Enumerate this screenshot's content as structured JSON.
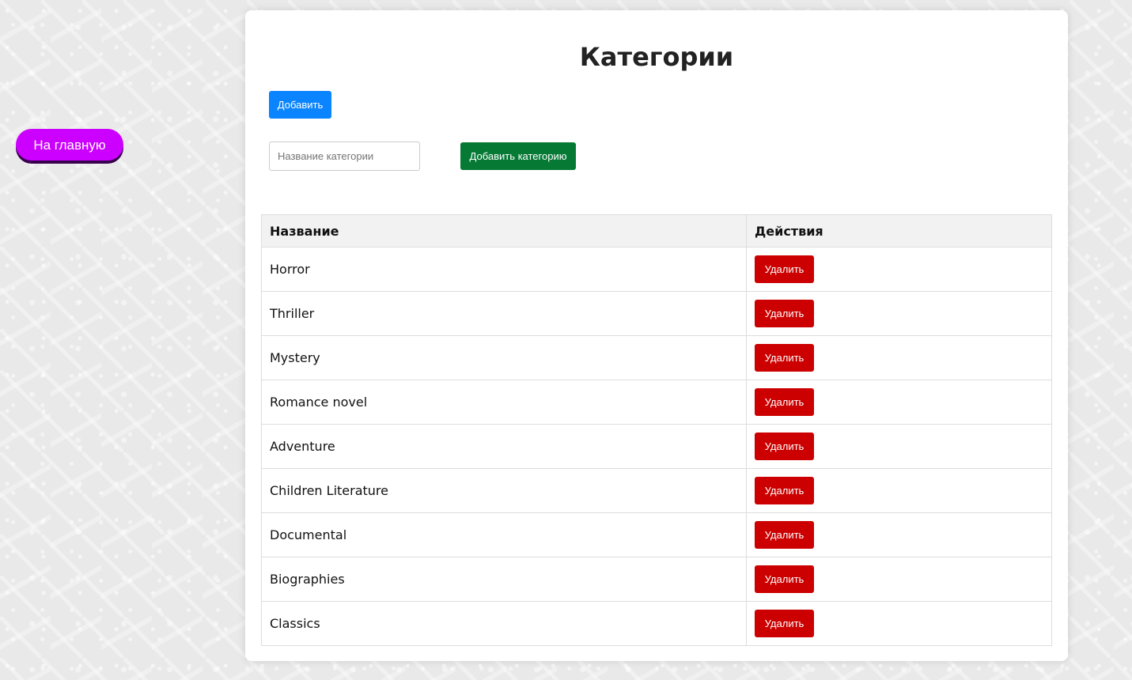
{
  "nav": {
    "home_label": "На главную"
  },
  "page": {
    "title": "Категории",
    "add_toggle_label": "Добавить",
    "input_placeholder": "Название категории",
    "add_category_label": "Добавить категорию"
  },
  "table": {
    "headers": [
      "Название",
      "Действия"
    ],
    "delete_label": "Удалить",
    "rows": [
      "Horror",
      "Thriller",
      "Mystery",
      "Romance novel",
      "Adventure",
      "Children Literature",
      "Documental",
      "Biographies",
      "Classics"
    ]
  },
  "colors": {
    "home_button": "#cc00ff",
    "add_toggle": "#0a84ff",
    "add_category": "#067a35",
    "delete_button": "#cc0000"
  }
}
